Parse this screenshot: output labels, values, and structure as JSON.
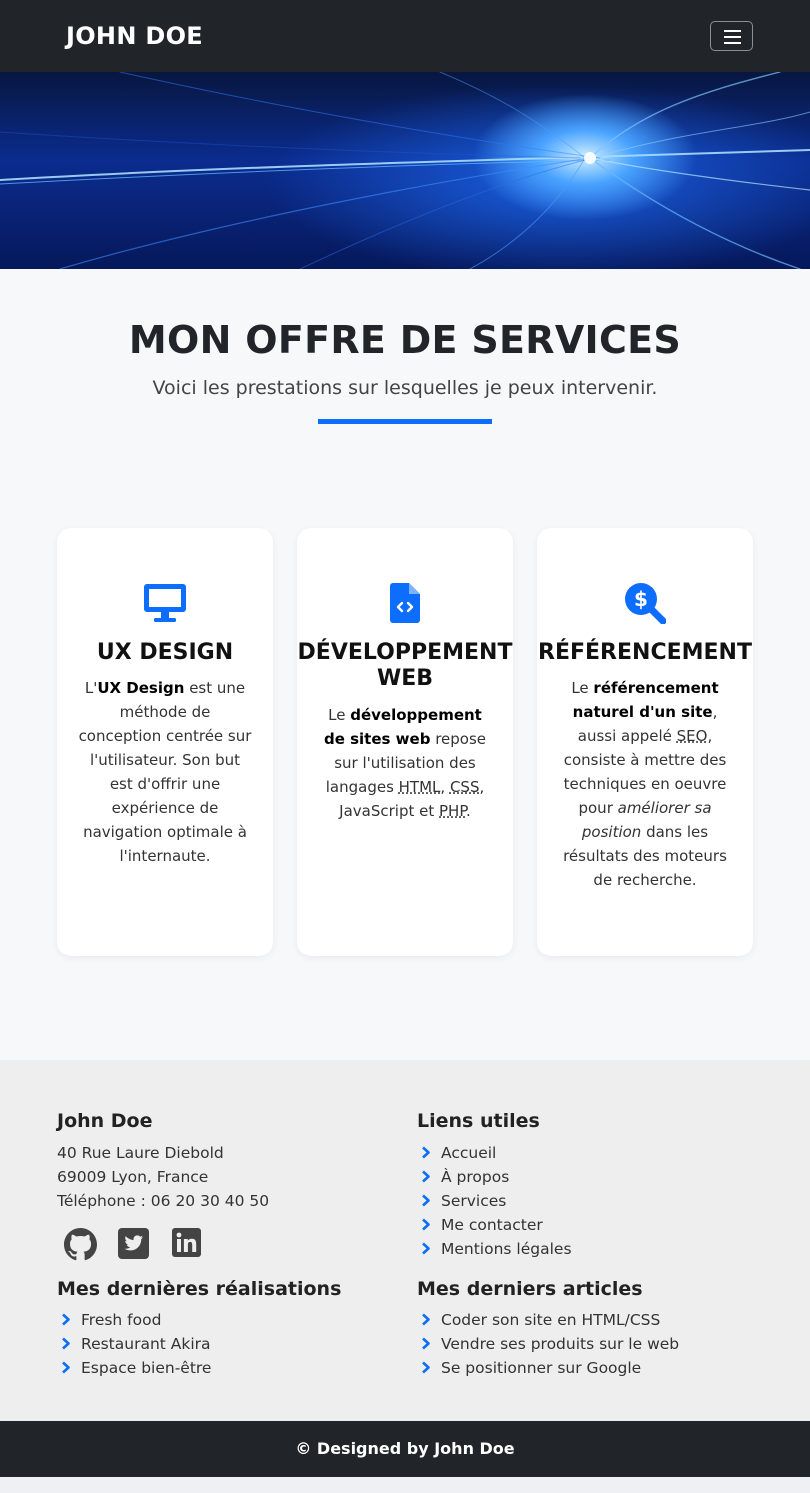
{
  "navbar": {
    "brand": "JOHN DOE",
    "menu_icon": "hamburger-menu-icon"
  },
  "hero": {
    "image": "blue-light-streaks-banner"
  },
  "services": {
    "title": "MON OFFRE DE SERVICES",
    "subtitle": "Voici les prestations sur lesquelles je peux intervenir.",
    "accent_color": "#0d6efd",
    "cards": [
      {
        "icon": "desktop-monitor-icon",
        "title": "UX DESIGN",
        "t0": "L'",
        "b1": "UX Design",
        "t2": " est une méthode de conception centrée sur l'utilisateur. Son but est d'offrir une expérience de navigation optimale à l'internaute."
      },
      {
        "icon": "file-code-icon",
        "title_line1": "DÉVELOPPEMENT",
        "title_line2": "WEB",
        "t0": "Le ",
        "b1": "développement de sites web",
        "t2": " repose sur l'utilisation des langages ",
        "a1": "HTML",
        "t3": ", ",
        "a2": "CSS",
        "t4": ", JavaScript et ",
        "a3": "PHP",
        "t5": "."
      },
      {
        "icon": "search-dollar-icon",
        "title": "RÉFÉRENCEMENT",
        "t0": "Le ",
        "b1": "référencement naturel d'un site",
        "t2": ", aussi appelé ",
        "a1": "SEO",
        "t3": ", consiste à mettre des techniques en oeuvre pour ",
        "i1": "améliorer sa position",
        "t4": " dans les résultats des moteurs de recherche."
      }
    ]
  },
  "footer": {
    "contact": {
      "title": "John Doe",
      "address1": "40 Rue Laure Diebold",
      "address2": "69009 Lyon, France",
      "phone": "Téléphone : 06 20 30 40 50"
    },
    "social_icons": [
      "github-icon",
      "twitter-icon",
      "linkedin-icon"
    ],
    "links": {
      "title": "Liens utiles",
      "items": [
        "Accueil",
        "À propos",
        "Services",
        "Me contacter",
        "Mentions légales"
      ]
    },
    "works": {
      "title": "Mes dernières réalisations",
      "items": [
        "Fresh food",
        "Restaurant Akira",
        "Espace bien-être"
      ]
    },
    "articles": {
      "title": "Mes derniers articles",
      "items": [
        "Coder son site en HTML/CSS",
        "Vendre ses produits sur le web",
        "Se positionner sur Google"
      ]
    }
  },
  "copyright": "© Designed by John Doe"
}
